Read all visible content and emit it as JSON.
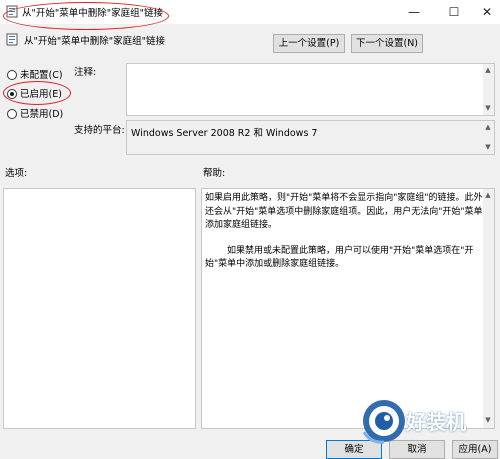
{
  "window": {
    "title": "从\"开始\"菜单中删除\"家庭组\"链接",
    "minimize_glyph": "—",
    "maximize_glyph": "☐",
    "close_glyph": "✕"
  },
  "header": {
    "setting_name": "从\"开始\"菜单中删除\"家庭组\"链接",
    "prev_button": "上一个设置(P)",
    "next_button": "下一个设置(N)"
  },
  "state": {
    "options": [
      {
        "label": "未配置(C)",
        "checked": false
      },
      {
        "label": "已启用(E)",
        "checked": true
      },
      {
        "label": "已禁用(D)",
        "checked": false
      }
    ]
  },
  "comment": {
    "label": "注释:",
    "value": ""
  },
  "platform": {
    "label": "支持的平台:",
    "value": "Windows Server 2008 R2 和 Windows 7"
  },
  "options_label": "选项:",
  "help_label": "帮助:",
  "help_text": [
    "如果启用此策略，则\"开始\"菜单将不会显示指向\"家庭组\"的链接。此外还会从\"开始\"菜单选项中删除家庭组项。因此，用户无法向\"开始\"菜单添加家庭组链接。",
    "如果禁用或未配置此策略，用户可以使用\"开始\"菜单选项在\"开始\"菜单中添加或删除家庭组链接。"
  ],
  "footer": {
    "ok_button": "确定",
    "cancel_button": "取消",
    "apply_button": "应用(A)"
  },
  "logo": {
    "text": "好装机"
  },
  "colors": {
    "annotation": "#d72424",
    "accent": "#0078d7",
    "logo_blue": "#1f5fa8"
  }
}
